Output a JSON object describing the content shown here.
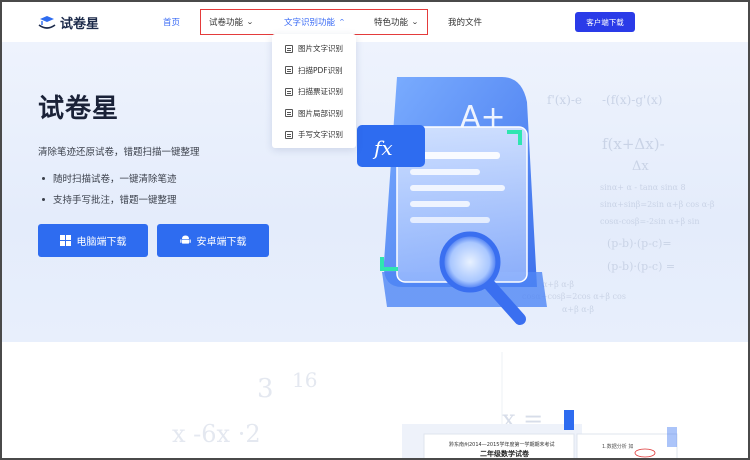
{
  "header": {
    "logo_text": "试卷星",
    "nav": [
      {
        "label": "首页",
        "active": true
      },
      {
        "label": "试卷功能",
        "has_dropdown": true
      },
      {
        "label": "文字识别功能",
        "has_dropdown": true,
        "active": true,
        "open": true
      },
      {
        "label": "特色功能",
        "has_dropdown": true
      },
      {
        "label": "我的文件"
      }
    ],
    "download_button": "客户端下载"
  },
  "dropdown": {
    "items": [
      "图片文字识别",
      "扫描PDF识别",
      "扫描票证识别",
      "图片局部识别",
      "手写文字识别"
    ]
  },
  "hero": {
    "title": "试卷星",
    "subtitle": "清除笔迹还原试卷，错题扫描一键整理",
    "bullets": [
      "随时扫描试卷，一键清除笔迹",
      "支持手写批注，错题一键整理"
    ],
    "pc_button": "电脑端下载",
    "android_button": "安卓端下载",
    "illustration_fx": "fx",
    "illustration_grade": "A+"
  },
  "lower": {
    "paper_title_1": "黔东南州2014—2015学年度第一学期期末考试",
    "paper_title_2": "二年级数学试卷"
  },
  "colors": {
    "accent": "#2e6cf0",
    "nav_active": "#3a6bf5",
    "download_btn": "#2a3be8",
    "highlight_box": "#e43b3b"
  }
}
